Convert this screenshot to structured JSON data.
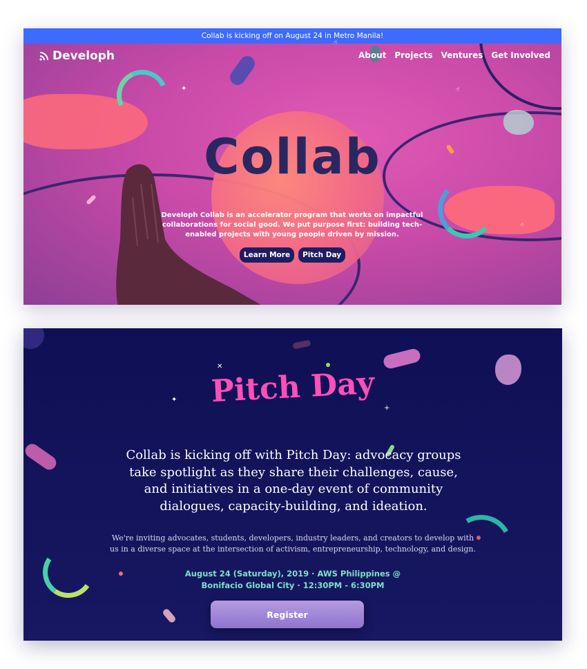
{
  "announcement": "Collab is kicking off on August 24 in Metro Manila!",
  "brand": {
    "name": "Developh"
  },
  "nav": {
    "items": [
      "About",
      "Projects",
      "Ventures",
      "Get Involved"
    ]
  },
  "hero": {
    "title": "Collab",
    "description": "Developh Collab is an accelerator program that works on impactful collaborations for social good. We put purpose first: building tech-enabled projects with young people driven by mission.",
    "buttons": [
      "Learn More",
      "Pitch Day"
    ]
  },
  "pitch": {
    "title": "Pitch Day",
    "lead": "Collab is kicking off with Pitch Day: advocacy groups take spotlight as they share their challenges, cause, and initiatives in a one-day event of community dialogues, capacity-building, and ideation.",
    "sub": "We're inviting advocates, students, developers, industry leaders, and creators to develop with us in a diverse space at the intersection of activism, entrepreneurship, technology, and design.",
    "date_line1": "August 24 (Saturday), 2019 · AWS Philippines @",
    "date_line2": "Bonifacio Global City · 12:30PM - 6:30PM",
    "register": "Register"
  },
  "colors": {
    "announce_bar": "#3d6bff",
    "hero_pink": "#c94aa8",
    "dark_navy": "#0f0f55",
    "pitch_pink": "#ff4fb8",
    "date_mint": "#7ee0c8"
  },
  "icons": [
    "wifi-logo-icon",
    "sparkle-icon",
    "hand-cursor-icon"
  ]
}
